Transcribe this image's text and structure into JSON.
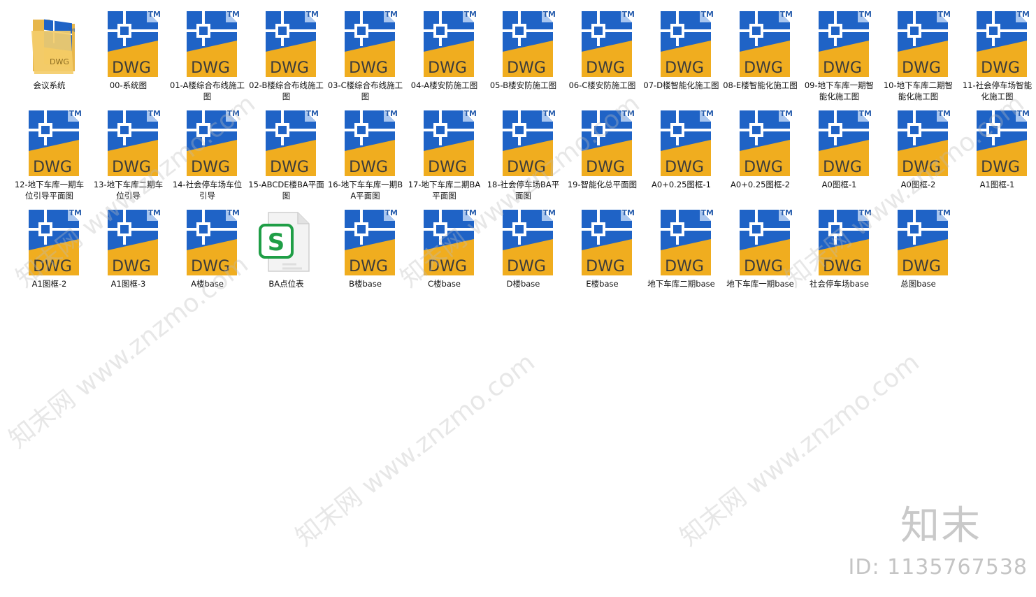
{
  "explorer": {
    "items": [
      {
        "label": "会议系统",
        "type": "folder"
      },
      {
        "label": "00-系统图",
        "type": "dwg"
      },
      {
        "label": "01-A楼综合布线施工图",
        "type": "dwg"
      },
      {
        "label": "02-B楼综合布线施工图",
        "type": "dwg"
      },
      {
        "label": "03-C楼综合布线施工图",
        "type": "dwg"
      },
      {
        "label": "04-A楼安防施工图",
        "type": "dwg"
      },
      {
        "label": "05-B楼安防施工图",
        "type": "dwg"
      },
      {
        "label": "06-C楼安防施工图",
        "type": "dwg"
      },
      {
        "label": "07-D楼智能化施工图",
        "type": "dwg"
      },
      {
        "label": "08-E楼智能化施工图",
        "type": "dwg"
      },
      {
        "label": "09-地下车库一期智能化施工图",
        "type": "dwg"
      },
      {
        "label": "10-地下车库二期智能化施工图",
        "type": "dwg"
      },
      {
        "label": "11-社会停车场智能化施工图",
        "type": "dwg"
      },
      {
        "label": "12-地下车库一期车位引导平面图",
        "type": "dwg"
      },
      {
        "label": "13-地下车库二期车位引导",
        "type": "dwg"
      },
      {
        "label": "14-社会停车场车位引导",
        "type": "dwg"
      },
      {
        "label": "15-ABCDE楼BA平面图",
        "type": "dwg"
      },
      {
        "label": "16-地下车车库一期BA平面图",
        "type": "dwg"
      },
      {
        "label": "17-地下车库二期BA平面图",
        "type": "dwg"
      },
      {
        "label": "18-社会停车场BA平面图",
        "type": "dwg"
      },
      {
        "label": "19-智能化总平面图",
        "type": "dwg"
      },
      {
        "label": "A0+0.25图框-1",
        "type": "dwg"
      },
      {
        "label": "A0+0.25图框-2",
        "type": "dwg"
      },
      {
        "label": "A0图框-1",
        "type": "dwg"
      },
      {
        "label": "A0图框-2",
        "type": "dwg"
      },
      {
        "label": "A1图框-1",
        "type": "dwg"
      },
      {
        "label": "A1图框-2",
        "type": "dwg"
      },
      {
        "label": "A1图框-3",
        "type": "dwg"
      },
      {
        "label": "A楼base",
        "type": "dwg"
      },
      {
        "label": "BA点位表",
        "type": "xls"
      },
      {
        "label": "B楼base",
        "type": "dwg"
      },
      {
        "label": "C楼base",
        "type": "dwg"
      },
      {
        "label": "D楼base",
        "type": "dwg"
      },
      {
        "label": "E楼base",
        "type": "dwg"
      },
      {
        "label": "地下车库二期base",
        "type": "dwg"
      },
      {
        "label": "地下车库一期base",
        "type": "dwg"
      },
      {
        "label": "社会停车场base",
        "type": "dwg"
      },
      {
        "label": "总图base",
        "type": "dwg"
      }
    ],
    "icon_text": {
      "dwg": "DWG",
      "tm": "TM",
      "xls": "S"
    },
    "colors": {
      "dwg_blue": "#1f63c6",
      "dwg_yellow": "#f0ad1f",
      "xls_green": "#1f9e46"
    }
  },
  "watermark": {
    "text": "知末网 www.znzmo.com",
    "brand": "知末",
    "id": "ID: 1135767538"
  }
}
